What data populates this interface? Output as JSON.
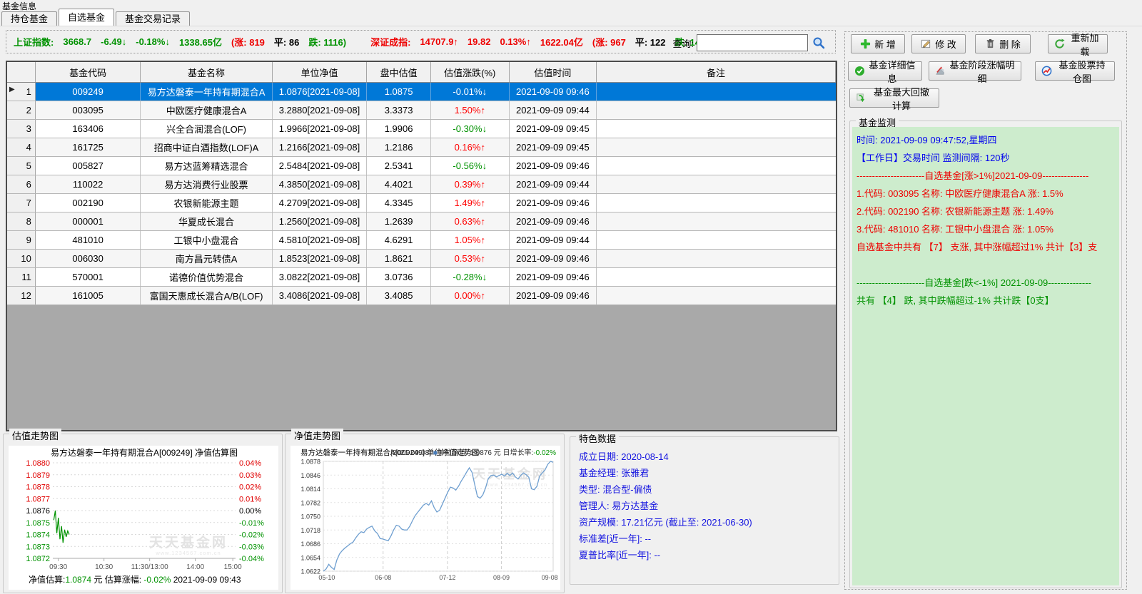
{
  "app": {
    "title_label": "基金信息"
  },
  "tabs": [
    {
      "label": "持仓基金"
    },
    {
      "label": "自选基金",
      "active": true
    },
    {
      "label": "基金交易记录"
    }
  ],
  "index_bar": {
    "sh_label": "上证指数:",
    "sh_value": "3668.7",
    "sh_chg": "-6.49↓",
    "sh_pct": "-0.18%↓",
    "sh_amt": "1338.65亿",
    "sh_up": "(涨: 819",
    "sh_flat": "平: 86",
    "sh_down": "跌: 1116)",
    "sz_label": "深证成指:",
    "sz_value": "14707.9↑",
    "sz_chg": "19.82",
    "sz_pct": "0.13%↑",
    "sz_amt": "1622.04亿",
    "sz_up": "(涨: 967",
    "sz_flat": "平: 122",
    "sz_down": "跌: 1440)",
    "query_label": "查询:",
    "query_value": ""
  },
  "table": {
    "headers": [
      "",
      "基金代码",
      "基金名称",
      "单位净值",
      "盘中估值",
      "估值涨跌(%)",
      "估值时间",
      "备注"
    ],
    "rows": [
      {
        "num": "1",
        "code": "009249",
        "name": "易方达磐泰一年持有期混合A",
        "nav": "1.0876[2021-09-08]",
        "est": "1.0875",
        "chg": "-0.01%↓",
        "trend": "down",
        "time": "2021-09-09 09:46",
        "remark": "",
        "selected": true
      },
      {
        "num": "2",
        "code": "003095",
        "name": "中欧医疗健康混合A",
        "nav": "3.2880[2021-09-08]",
        "est": "3.3373",
        "chg": "1.50%↑",
        "trend": "up",
        "time": "2021-09-09 09:44",
        "remark": ""
      },
      {
        "num": "3",
        "code": "163406",
        "name": "兴全合润混合(LOF)",
        "nav": "1.9966[2021-09-08]",
        "est": "1.9906",
        "chg": "-0.30%↓",
        "trend": "down",
        "time": "2021-09-09 09:45",
        "remark": ""
      },
      {
        "num": "4",
        "code": "161725",
        "name": "招商中证白酒指数(LOF)A",
        "nav": "1.2166[2021-09-08]",
        "est": "1.2186",
        "chg": "0.16%↑",
        "trend": "up",
        "time": "2021-09-09 09:45",
        "remark": ""
      },
      {
        "num": "5",
        "code": "005827",
        "name": "易方达蓝筹精选混合",
        "nav": "2.5484[2021-09-08]",
        "est": "2.5341",
        "chg": "-0.56%↓",
        "trend": "down",
        "time": "2021-09-09 09:46",
        "remark": ""
      },
      {
        "num": "6",
        "code": "110022",
        "name": "易方达消费行业股票",
        "nav": "4.3850[2021-09-08]",
        "est": "4.4021",
        "chg": "0.39%↑",
        "trend": "up",
        "time": "2021-09-09 09:44",
        "remark": ""
      },
      {
        "num": "7",
        "code": "002190",
        "name": "农银新能源主题",
        "nav": "4.2709[2021-09-08]",
        "est": "4.3345",
        "chg": "1.49%↑",
        "trend": "up",
        "time": "2021-09-09 09:46",
        "remark": ""
      },
      {
        "num": "8",
        "code": "000001",
        "name": "华夏成长混合",
        "nav": "1.2560[2021-09-08]",
        "est": "1.2639",
        "chg": "0.63%↑",
        "trend": "up",
        "time": "2021-09-09 09:46",
        "remark": ""
      },
      {
        "num": "9",
        "code": "481010",
        "name": "工银中小盘混合",
        "nav": "4.5810[2021-09-08]",
        "est": "4.6291",
        "chg": "1.05%↑",
        "trend": "up",
        "time": "2021-09-09 09:44",
        "remark": ""
      },
      {
        "num": "10",
        "code": "006030",
        "name": "南方昌元转债A",
        "nav": "1.8523[2021-09-08]",
        "est": "1.8621",
        "chg": "0.53%↑",
        "trend": "up",
        "time": "2021-09-09 09:46",
        "remark": ""
      },
      {
        "num": "11",
        "code": "570001",
        "name": "诺德价值优势混合",
        "nav": "3.0822[2021-09-08]",
        "est": "3.0736",
        "chg": "-0.28%↓",
        "trend": "down",
        "time": "2021-09-09 09:46",
        "remark": ""
      },
      {
        "num": "12",
        "code": "161005",
        "name": "富国天惠成长混合A/B(LOF)",
        "nav": "3.4086[2021-09-08]",
        "est": "3.4085",
        "chg": "0.00%↑",
        "trend": "up",
        "time": "2021-09-09 09:46",
        "remark": ""
      }
    ]
  },
  "toolbar": {
    "buttons": [
      {
        "label": "新 增",
        "icon": "plus-icon"
      },
      {
        "label": "修 改",
        "icon": "edit-icon"
      },
      {
        "label": "删 除",
        "icon": "delete-icon"
      },
      {
        "label": "重新加载",
        "icon": "reload-icon"
      },
      {
        "label": "基金详细信息",
        "icon": "check-circle-icon"
      },
      {
        "label": "基金阶段涨幅明细",
        "icon": "stage-chart-icon"
      },
      {
        "label": "基金股票持仓图",
        "icon": "holdings-chart-icon"
      },
      {
        "label": "基金最大回撤计算",
        "icon": "drawdown-icon"
      }
    ]
  },
  "groups": {
    "monitor": "基金监测",
    "est": "估值走势图",
    "nav": "净值走势图",
    "features": "特色数据"
  },
  "monitor": {
    "lines": [
      {
        "text": "时间: 2021-09-09 09:47:52,星期四",
        "color": "blue"
      },
      {
        "text": "【工作日】交易时间 监测间隔: 120秒",
        "color": "blue"
      },
      {
        "text": "----------------------自选基金[涨>1%]2021-09-09---------------",
        "color": "red"
      },
      {
        "text": "1.代码: 003095 名称: 中欧医疗健康混合A  涨: 1.5%",
        "color": "red"
      },
      {
        "text": "2.代码: 002190 名称: 农银新能源主题  涨: 1.49%",
        "color": "red"
      },
      {
        "text": "3.代码: 481010 名称: 工银中小盘混合  涨: 1.05%",
        "color": "red"
      },
      {
        "text": "自选基金中共有 【7】 支涨, 其中涨幅超过1% 共计【3】支",
        "color": "red"
      },
      {
        "text": "",
        "color": "red"
      },
      {
        "text": "----------------------自选基金[跌<-1%] 2021-09-09--------------",
        "color": "green"
      },
      {
        "text": "共有 【4】 跌, 其中跌幅超过-1% 共计跌【0支】",
        "color": "green"
      }
    ]
  },
  "features": {
    "lines": [
      "成立日期: 2020-08-14",
      "基金经理: 张雅君",
      "类型: 混合型-偏债",
      "管理人: 易方达基金",
      "资产规模: 17.21亿元 (截止至: 2021-06-30)",
      "标准差[近一年]: --",
      "夏普比率[近一年]: --"
    ]
  },
  "chart_data": [
    {
      "type": "line",
      "title": "易方达磐泰一年持有期混合A[009249] 净值估算图",
      "ylim": [
        1.0872,
        1.088
      ],
      "y_ticks_left": [
        "1.0880",
        "1.0879",
        "1.0878",
        "1.0877",
        "1.0876",
        "1.0875",
        "1.0874",
        "1.0873",
        "1.0872"
      ],
      "y_ticks_right": [
        "0.04%",
        "0.03%",
        "0.02%",
        "0.01%",
        "0.00%",
        "-0.01%",
        "-0.02%",
        "-0.03%",
        "-0.04%"
      ],
      "x_ticks": [
        "09:30",
        "10:30",
        "11:30/13:00",
        "14:00",
        "15:00"
      ],
      "x_tick_fracs": [
        0.03,
        0.28,
        0.53,
        0.78,
        0.985
      ],
      "series": [
        {
          "name": "净值估算",
          "color": "#009200",
          "x_span": [
            0.005,
            0.09
          ],
          "values": [
            1.08752,
            1.0876,
            1.08741,
            1.08754,
            1.08736,
            1.08747,
            1.08733,
            1.08744,
            1.08738,
            1.08743,
            1.0874
          ]
        }
      ],
      "watermark": "天天基金网",
      "watermark_sub": "www.1234567.com.cn",
      "status": [
        {
          "text": "净值估算:",
          "color": "#000000"
        },
        {
          "text": "1.0874",
          "color": "#009200"
        },
        {
          "text": " 元 估算涨幅: ",
          "color": "#000000"
        },
        {
          "text": "-0.02%",
          "color": "#009200"
        },
        {
          "text": " 2021-09-09 09:43",
          "color": "#000000"
        }
      ]
    },
    {
      "type": "line",
      "title": "易方达磐泰一年持有期混合A[009249] 单位净值走势图",
      "legend": [
        {
          "text": "[2021-09-08]  ",
          "color": "#333333"
        },
        {
          "text": "■",
          "color": "#4a7ebb"
        },
        {
          "text": "单位净值: 1.0876 元 日增长率:",
          "color": "#333333"
        },
        {
          "text": "-0.02%",
          "color": "#009200"
        }
      ],
      "ylim": [
        1.0622,
        1.0878
      ],
      "y_ticks": [
        "1.0878",
        "1.0846",
        "1.0814",
        "1.0782",
        "1.0750",
        "1.0718",
        "1.0686",
        "1.0654",
        "1.0622"
      ],
      "x_ticks": [
        "05-10",
        "06-08",
        "07-12",
        "08-09",
        "09-08"
      ],
      "x_tick_fracs": [
        0.015,
        0.26,
        0.54,
        0.775,
        0.985
      ],
      "series": [
        {
          "name": "单位净值",
          "color": "#6f9fd0",
          "values": [
            1.0622,
            1.0627,
            1.0638,
            1.0631,
            1.0626,
            1.0648,
            1.0662,
            1.067,
            1.0676,
            1.0681,
            1.0686,
            1.069,
            1.07,
            1.0708,
            1.0714,
            1.0712,
            1.072,
            1.0724,
            1.0727,
            1.0716,
            1.071,
            1.0698,
            1.0697,
            1.0695,
            1.0693,
            1.0704,
            1.0718,
            1.0729,
            1.0727,
            1.072,
            1.0718,
            1.0718,
            1.0727,
            1.074,
            1.0752,
            1.076,
            1.0768,
            1.0776,
            1.078,
            1.0776,
            1.0786,
            1.077,
            1.076,
            1.0764,
            1.0778,
            1.0792,
            1.0806,
            1.0818,
            1.0816,
            1.0811,
            1.082,
            1.0832,
            1.0842,
            1.0853,
            1.0863,
            1.0852,
            1.0824,
            1.0796,
            1.0792,
            1.08,
            1.0816,
            1.0838,
            1.0845,
            1.0846,
            1.0842,
            1.0845,
            1.0848,
            1.0844,
            1.085,
            1.0845,
            1.0851,
            1.0842,
            1.0837,
            1.0845,
            1.0851,
            1.0847,
            1.0841,
            1.0814,
            1.0812,
            1.082,
            1.0844,
            1.0851,
            1.0858,
            1.0871,
            1.0878,
            1.0876
          ]
        }
      ],
      "watermark": "天天基金网",
      "watermark_sub": "www.1234567.com.cn"
    }
  ],
  "colors": {
    "up": "#ff0000",
    "down": "#009200",
    "selected_row": "#0078d7",
    "monitor_bg": "#cdeccd",
    "blue_text": "#1414e0"
  }
}
